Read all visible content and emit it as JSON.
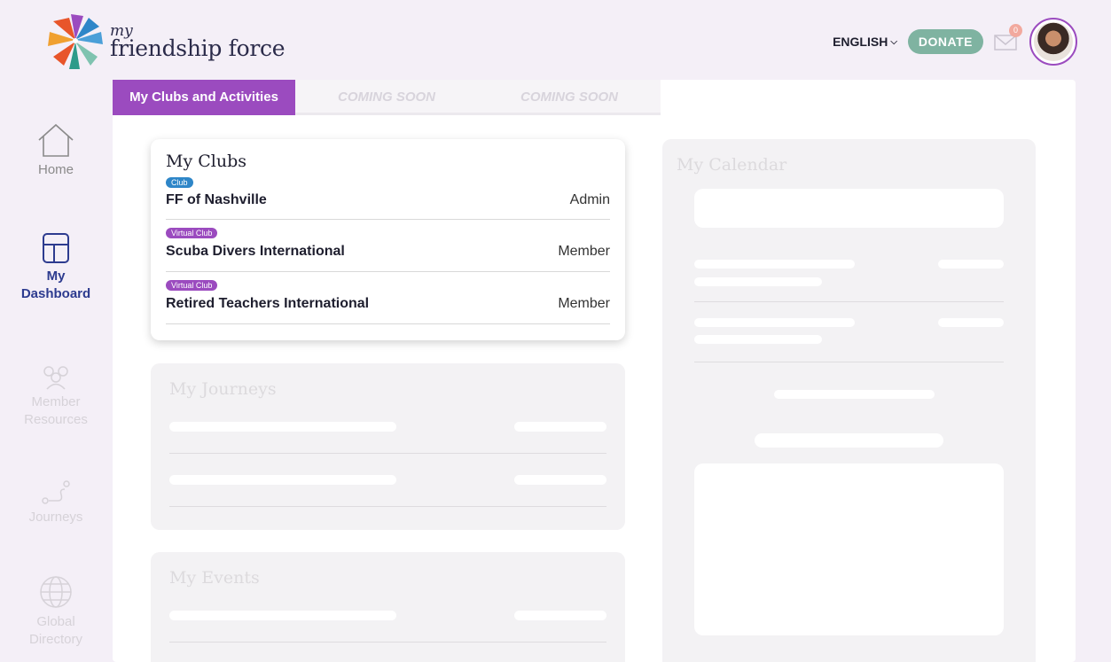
{
  "header": {
    "logo_my": "my",
    "logo_name": "friendship force",
    "language": "ENGLISH",
    "donate_label": "DONATE",
    "mail_count": "0"
  },
  "sidebar": {
    "items": [
      {
        "label": "Home",
        "icon": "home-icon",
        "state": "normal"
      },
      {
        "label": "My\nDashboard",
        "icon": "dashboard-icon",
        "state": "active"
      },
      {
        "label": "Member\nResources",
        "icon": "people-icon",
        "state": "faded"
      },
      {
        "label": "Journeys",
        "icon": "route-icon",
        "state": "faded"
      },
      {
        "label": "Global\nDirectory",
        "icon": "globe-icon",
        "state": "faded"
      }
    ]
  },
  "tabs": [
    {
      "label": "My Clubs and Activities",
      "active": true
    },
    {
      "label": "COMING SOON",
      "active": false
    },
    {
      "label": "COMING SOON",
      "active": false
    }
  ],
  "clubs": {
    "title": "My Clubs",
    "rows": [
      {
        "badge": "Club",
        "badge_color": "#2e86c8",
        "name": "FF of Nashville",
        "role": "Admin"
      },
      {
        "badge": "Virtual Club",
        "badge_color": "#9b4bbf",
        "name": "Scuba Divers International",
        "role": "Member"
      },
      {
        "badge": "Virtual Club",
        "badge_color": "#9b4bbf",
        "name": "Retired Teachers International",
        "role": "Member"
      }
    ]
  },
  "journeys": {
    "title": "My Journeys"
  },
  "events": {
    "title": "My Events"
  },
  "calendar": {
    "title": "My Calendar"
  },
  "colors": {
    "accent": "#9b4bbf",
    "donate": "#7fb3a1",
    "nav_active": "#2d3b8f"
  }
}
